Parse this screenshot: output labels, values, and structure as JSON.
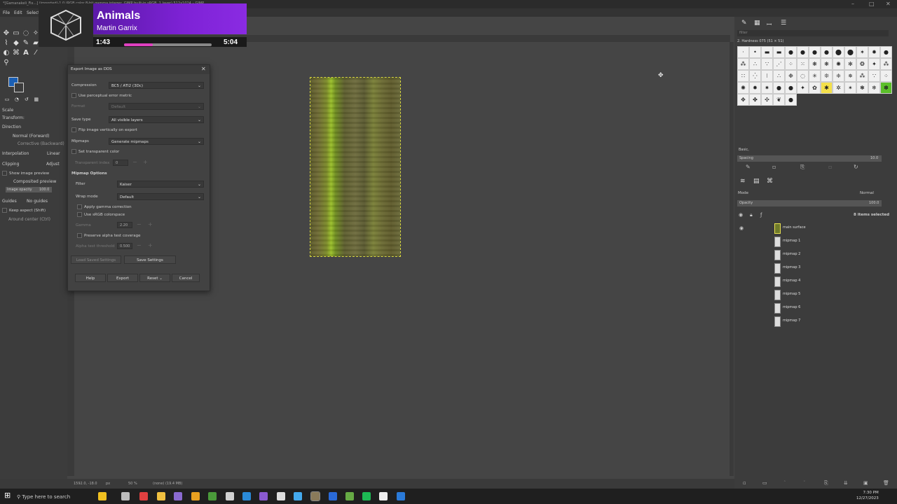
{
  "window": {
    "title": "*[Gamanakeli_Fix...] (imported)-1.0 (RGB color 8-bit gamma integer, GIMP built-in sRGB, 1 layer) 512x1024 – GIMP"
  },
  "menu": [
    "File",
    "Edit",
    "Select"
  ],
  "music": {
    "title": "Animals",
    "artist": "Martin Garrix",
    "elapsed": "1:43",
    "total": "5:04",
    "progress": 0.33
  },
  "tool_options": {
    "scale": "Scale",
    "transform": "Transform:",
    "direction": "Direction",
    "dir_normal": "Normal (Forward)",
    "dir_corrective": "Corrective (Backward)",
    "interpolation": "Interpolation",
    "interpolation_value": "Linear",
    "clipping": "Clipping",
    "clipping_value": "Adjust",
    "show_preview": "Show image preview",
    "composited_preview": "Composited preview",
    "image_opacity_label": "Image opacity",
    "image_opacity_value": "100.0",
    "guides": "Guides",
    "guides_value": "No guides",
    "keep_aspect": "Keep aspect (Shift)",
    "around_center": "Around center (Ctrl)"
  },
  "dialog": {
    "title": "Export Image as DDS",
    "compression_label": "Compression",
    "compression_value": "BC5 / ATI2 (3Dc)",
    "perceptual": "Use perceptual error metric",
    "format_label": "Format",
    "format_value": "Default",
    "save_type_label": "Save type",
    "save_type_value": "All visible layers",
    "flip": "Flip image vertically on export",
    "mipmaps_label": "Mipmaps",
    "mipmaps_value": "Generate mipmaps",
    "transparent_color": "Set transparent color",
    "transparent_index_label": "Transparent index",
    "transparent_index_value": "0",
    "mipmap_options": "Mipmap Options",
    "filter_label": "Filter",
    "filter_value": "Kaiser",
    "wrap_label": "Wrap mode",
    "wrap_value": "Default",
    "gamma_correction": "Apply gamma correction",
    "srgb": "Use sRGB colorspace",
    "gamma_label": "Gamma",
    "gamma_value": "2.20",
    "preserve_alpha": "Preserve alpha test coverage",
    "alpha_threshold_label": "Alpha test threshold",
    "alpha_threshold_value": "0.500",
    "load_settings": "Load Saved Settings",
    "save_settings": "Save Settings",
    "help": "Help",
    "export": "Export",
    "reset": "Reset",
    "cancel": "Cancel"
  },
  "status": {
    "coords": "1592.0, -18.0",
    "unit": "px",
    "zoom": "50 %",
    "info": "(none) (19.4 MB)"
  },
  "brushes": {
    "filter_placeholder": "filter",
    "brush_name": "2. Hardness 075 (51 × 51)",
    "preset": "Basic,",
    "spacing_label": "Spacing",
    "spacing_value": "10.0"
  },
  "layers": {
    "mode_label": "Mode",
    "mode_value": "Normal",
    "opacity_label": "Opacity",
    "opacity_value": "100.0",
    "selected": "8 items selected",
    "items": [
      "main surface",
      "mipmap 1",
      "mipmap 2",
      "mipmap 3",
      "mipmap 4",
      "mipmap 5",
      "mipmap 6",
      "mipmap 7"
    ]
  },
  "taskbar": {
    "search": "Type here to search",
    "time": "7:30 PM",
    "date": "12/27/2023"
  },
  "colors": {
    "accent": "#7e22d6",
    "progress": "#e040c0",
    "fg_swatch": "#1a5fb4"
  }
}
